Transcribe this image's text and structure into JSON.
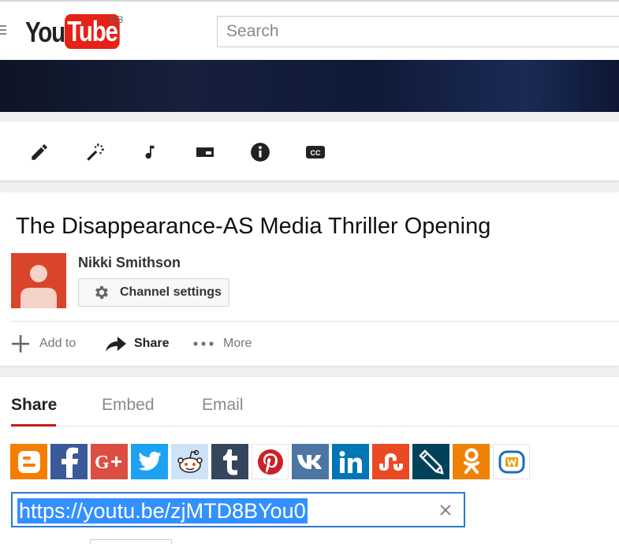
{
  "header": {
    "logo_you": "You",
    "logo_tube": "Tube",
    "region": "GB",
    "search_placeholder": "Search"
  },
  "editor_tools": [
    {
      "icon": "pencil-icon",
      "label": "Info and settings"
    },
    {
      "icon": "magic-wand-icon",
      "label": "Enhancements"
    },
    {
      "icon": "music-note-icon",
      "label": "Audio"
    },
    {
      "icon": "end-screen-icon",
      "label": "End screen"
    },
    {
      "icon": "info-icon",
      "label": "Cards"
    },
    {
      "icon": "cc-icon",
      "label": "Subtitles"
    }
  ],
  "video": {
    "title": "The Disappearance-AS Media Thriller Opening",
    "owner": "Nikki Smithson",
    "channel_settings_label": "Channel settings"
  },
  "actions": {
    "add_to": "Add to",
    "share": "Share",
    "more": "More"
  },
  "share_panel": {
    "tabs": [
      "Share",
      "Embed",
      "Email"
    ],
    "active_tab": "Share",
    "url": "https://youtu.be/zjMTD8BYou0",
    "services": [
      {
        "name": "blogger-icon",
        "color": "#f57d00"
      },
      {
        "name": "facebook-icon",
        "color": "#3b5998"
      },
      {
        "name": "google-plus-icon",
        "color": "#dc4e41"
      },
      {
        "name": "twitter-icon",
        "color": "#1da1f2"
      },
      {
        "name": "reddit-icon",
        "color": "#cee3f8"
      },
      {
        "name": "tumblr-icon",
        "color": "#35465c"
      },
      {
        "name": "pinterest-icon",
        "color": "#ffffff"
      },
      {
        "name": "vk-icon",
        "color": "#4c75a3"
      },
      {
        "name": "linkedin-icon",
        "color": "#0077b5"
      },
      {
        "name": "stumbleupon-icon",
        "color": "#eb4924"
      },
      {
        "name": "livejournal-icon",
        "color": "#004359"
      },
      {
        "name": "odnoklassniki-icon",
        "color": "#ee8208"
      },
      {
        "name": "mixi-icon",
        "color": "#ffffff"
      }
    ]
  },
  "colors": {
    "brand_red": "#e62117",
    "tab_underline": "#cc181e",
    "selection": "#3390ff",
    "focus_border": "#2a7ad2"
  }
}
